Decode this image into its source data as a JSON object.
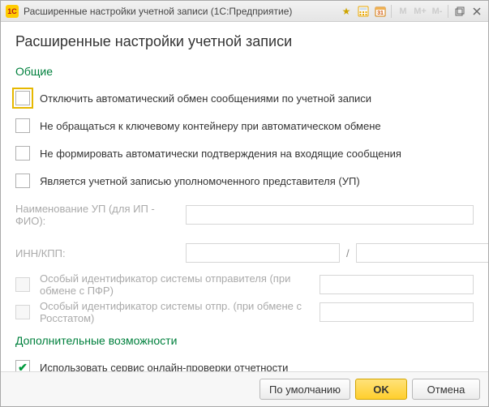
{
  "titlebar": {
    "app_icon_text": "1C",
    "title": "Расширенные настройки учетной записи  (1С:Предприятие)",
    "mem_labels": {
      "m": "M",
      "mplus": "M+",
      "mminus": "M-"
    }
  },
  "page": {
    "title": "Расширенные настройки учетной записи"
  },
  "sections": {
    "general": "Общие",
    "extra": "Дополнительные возможности"
  },
  "checks": {
    "disable_auto_exchange": "Отключить автоматический обмен сообщениями по учетной записи",
    "no_key_container": "Не обращаться к ключевому контейнеру при автоматическом обмене",
    "no_auto_confirm": "Не формировать автоматически подтверждения на входящие сообщения",
    "is_representative": "Является учетной записью уполномоченного представителя (УП)",
    "special_sender_pfr": "Особый идентификатор системы отправителя (при обмене с ПФР)",
    "special_sender_rosstat": "Особый идентификатор системы отпр. (при обмене с Росстатом)",
    "use_online_check": "Использовать сервис онлайн-проверки отчетности"
  },
  "fields": {
    "up_name_label": "Наименование УП (для ИП - ФИО):",
    "up_name_value": "",
    "inn_kpp_label": "ИНН/КПП:",
    "inn_value": "",
    "kpp_value": "",
    "separator": "/",
    "pfr_id_value": "",
    "rosstat_id_value": ""
  },
  "footer": {
    "defaults": "По умолчанию",
    "ok": "OK",
    "cancel": "Отмена"
  }
}
